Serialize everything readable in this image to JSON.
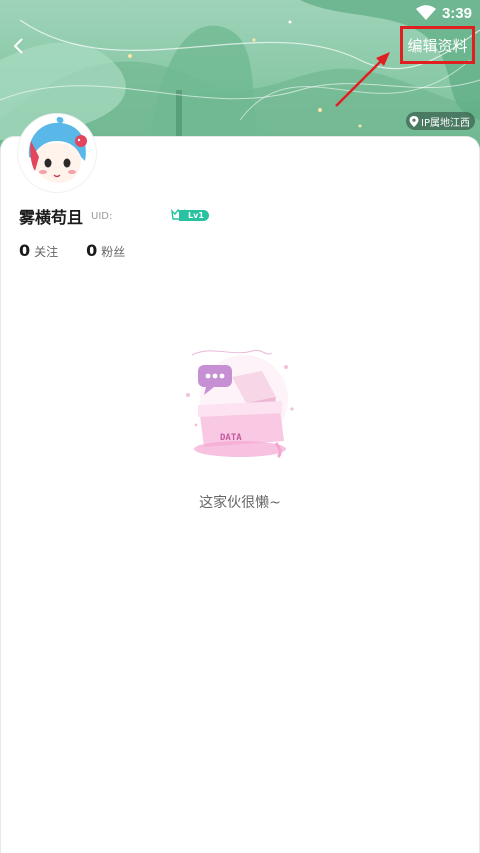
{
  "status_bar": {
    "time": "3:39",
    "wifi_icon": "wifi-icon"
  },
  "header": {
    "back_icon": "chevron-left-icon",
    "edit_label": "编辑资料",
    "ip_location": "IP属地江西"
  },
  "profile": {
    "name": "雾横苟且",
    "uid_label": "UID:",
    "level": "Lv1",
    "following_count": "0",
    "following_label": "关注",
    "fans_count": "0",
    "fans_label": "粉丝"
  },
  "empty_state": {
    "illustration_text": "DATA",
    "message": "这家伙很懒~"
  },
  "colors": {
    "banner_green": "#8ccaa9",
    "highlight_red": "#e02020",
    "level_teal": "#28c2a0"
  }
}
